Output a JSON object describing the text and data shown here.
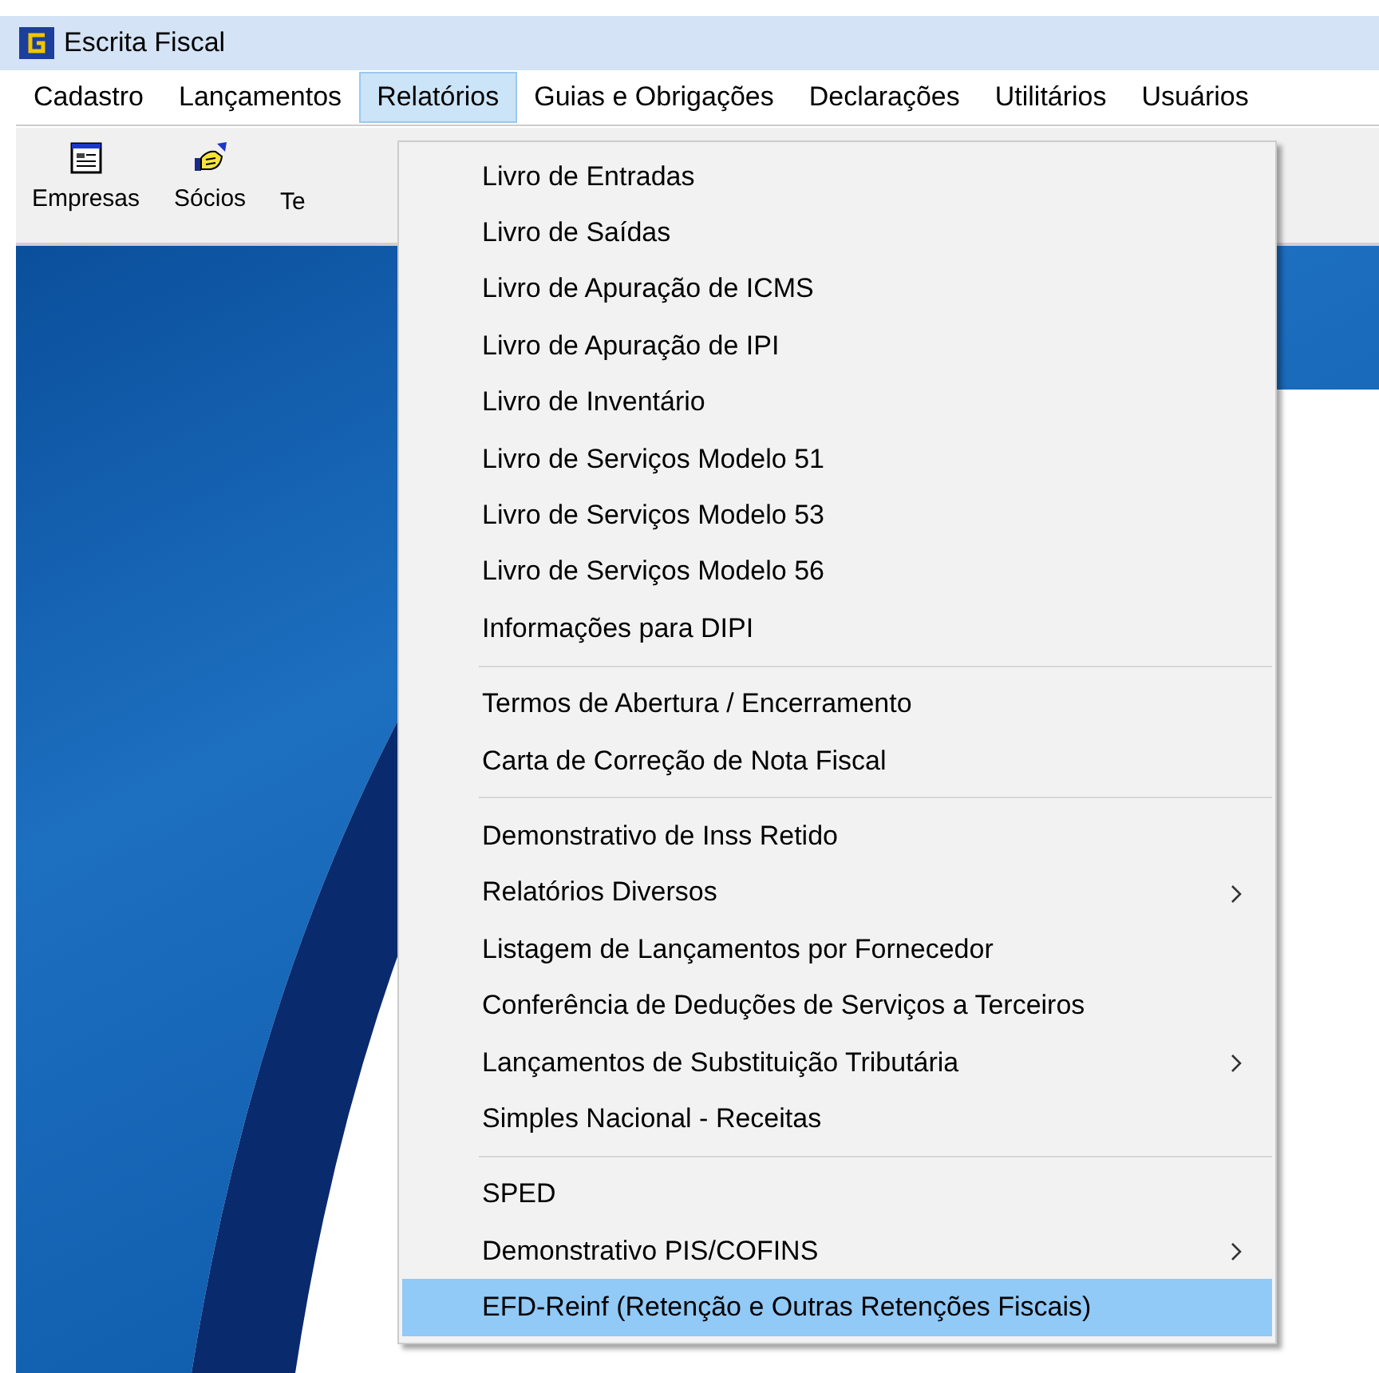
{
  "window": {
    "title": "Escrita Fiscal"
  },
  "menubar": [
    {
      "label": "Cadastro",
      "selected": false
    },
    {
      "label": "Lançamentos",
      "selected": false
    },
    {
      "label": "Relatórios",
      "selected": true
    },
    {
      "label": "Guias e Obrigações",
      "selected": false
    },
    {
      "label": "Declarações",
      "selected": false
    },
    {
      "label": "Utilitários",
      "selected": false
    },
    {
      "label": "Usuários",
      "selected": false
    }
  ],
  "toolbar": [
    {
      "label": "Empresas",
      "kind": "form"
    },
    {
      "label": "Sócios",
      "kind": "handshake"
    },
    {
      "label": "Te",
      "kind": "covered"
    }
  ],
  "menu": {
    "groups": [
      [
        {
          "label": "Livro de Entradas",
          "submenu": false,
          "selected": false
        },
        {
          "label": "Livro de Saídas",
          "submenu": false,
          "selected": false
        },
        {
          "label": "Livro de Apuração de ICMS",
          "submenu": false,
          "selected": false
        },
        {
          "label": "Livro de Apuração de IPI",
          "submenu": false,
          "selected": false
        },
        {
          "label": "Livro de Inventário",
          "submenu": false,
          "selected": false
        },
        {
          "label": "Livro de Serviços Modelo 51",
          "submenu": false,
          "selected": false
        },
        {
          "label": "Livro de Serviços Modelo 53",
          "submenu": false,
          "selected": false
        },
        {
          "label": "Livro de Serviços Modelo 56",
          "submenu": false,
          "selected": false
        },
        {
          "label": "Informações para DIPI",
          "submenu": false,
          "selected": false
        }
      ],
      [
        {
          "label": "Termos de Abertura / Encerramento",
          "submenu": false,
          "selected": false
        },
        {
          "label": "Carta de Correção de Nota Fiscal",
          "submenu": false,
          "selected": false
        }
      ],
      [
        {
          "label": "Demonstrativo de Inss Retido",
          "submenu": false,
          "selected": false
        },
        {
          "label": "Relatórios Diversos",
          "submenu": true,
          "selected": false
        },
        {
          "label": "Listagem de Lançamentos por Fornecedor",
          "submenu": false,
          "selected": false
        },
        {
          "label": "Conferência de Deduções de Serviços a Terceiros",
          "submenu": false,
          "selected": false
        },
        {
          "label": "Lançamentos de Substituição Tributária",
          "submenu": true,
          "selected": false
        },
        {
          "label": "Simples Nacional - Receitas",
          "submenu": false,
          "selected": false
        }
      ],
      [
        {
          "label": "SPED",
          "submenu": false,
          "selected": false
        },
        {
          "label": "Demonstrativo PIS/COFINS",
          "submenu": true,
          "selected": false
        },
        {
          "label": "EFD-Reinf (Retenção e Outras Retenções Fiscais)",
          "submenu": false,
          "selected": true
        }
      ]
    ]
  }
}
